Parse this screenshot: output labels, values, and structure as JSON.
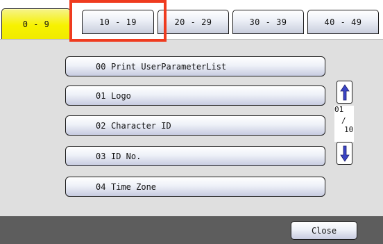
{
  "tabs": [
    {
      "label": "0 - 9",
      "active": true
    },
    {
      "label": "10 - 19",
      "active": false
    },
    {
      "label": "20 - 29",
      "active": false
    },
    {
      "label": "30 - 39",
      "active": false
    },
    {
      "label": "40 - 49",
      "active": false
    }
  ],
  "params": [
    {
      "number": "00",
      "label": "Print UserParameterList"
    },
    {
      "number": "01",
      "label": "Logo"
    },
    {
      "number": "02",
      "label": "Character ID"
    },
    {
      "number": "03",
      "label": "ID No."
    },
    {
      "number": "04",
      "label": "Time Zone"
    }
  ],
  "pager": {
    "current": "01",
    "separator": "/",
    "total": "10"
  },
  "icons": {
    "scroll_up": "arrow-up-icon",
    "scroll_down": "arrow-down-icon"
  },
  "colors": {
    "active_tab": "#f7f200",
    "highlight": "#ef3b1f",
    "arrow": "#3a44c4",
    "footer": "#5d5d5d"
  },
  "footer": {
    "close_label": "Close"
  }
}
